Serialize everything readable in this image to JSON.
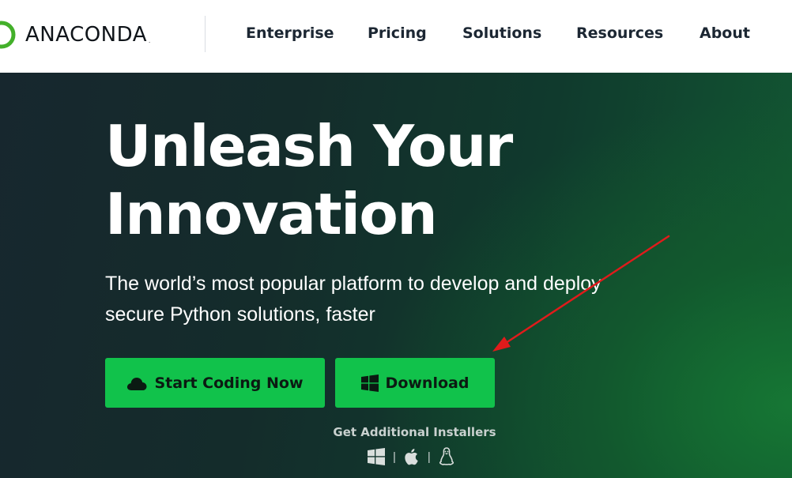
{
  "header": {
    "logo_text": "ANACONDA",
    "logo_mark": ".",
    "nav": [
      {
        "label": "Enterprise"
      },
      {
        "label": "Pricing"
      },
      {
        "label": "Solutions"
      },
      {
        "label": "Resources"
      },
      {
        "label": "About"
      }
    ]
  },
  "hero": {
    "title_line1": "Unleash Your",
    "title_line2": "Innovation",
    "subtitle_line1": "The world’s most popular platform to develop and deploy",
    "subtitle_line2": "secure Python solutions, faster",
    "start_label": "Start Coding Now",
    "download_label": "Download",
    "installers_label": "Get Additional Installers",
    "installer_icons": [
      "windows-icon",
      "apple-icon",
      "linux-icon"
    ],
    "separator": "|"
  },
  "colors": {
    "accent_green": "#11c24b",
    "logo_green": "#43b02a",
    "annotation_red": "#e01b1b"
  }
}
